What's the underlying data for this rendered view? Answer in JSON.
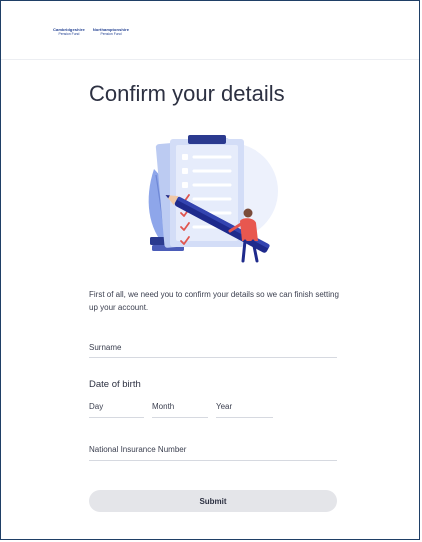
{
  "header": {
    "logo": {
      "left_main": "Cambridgeshire",
      "left_sub": "Pension Fund",
      "right_main": "Northamptonshire",
      "right_sub": "Pension Fund"
    }
  },
  "page": {
    "title": "Confirm your details",
    "intro": "First of all, we need you to confirm your details so we can finish setting up your account."
  },
  "form": {
    "surname_placeholder": "Surname",
    "dob_label": "Date of birth",
    "day_placeholder": "Day",
    "month_placeholder": "Month",
    "year_placeholder": "Year",
    "ni_placeholder": "National Insurance Number",
    "submit_label": "Submit"
  },
  "colors": {
    "frame_border": "#1f3f66",
    "brand_blue": "#1d3c8f",
    "clipboard": "#cfdaf6",
    "leaf": "#8ea6ea",
    "pencil": "#1e2a8c",
    "check": "#e0564f",
    "button_bg": "#e4e5e9"
  }
}
